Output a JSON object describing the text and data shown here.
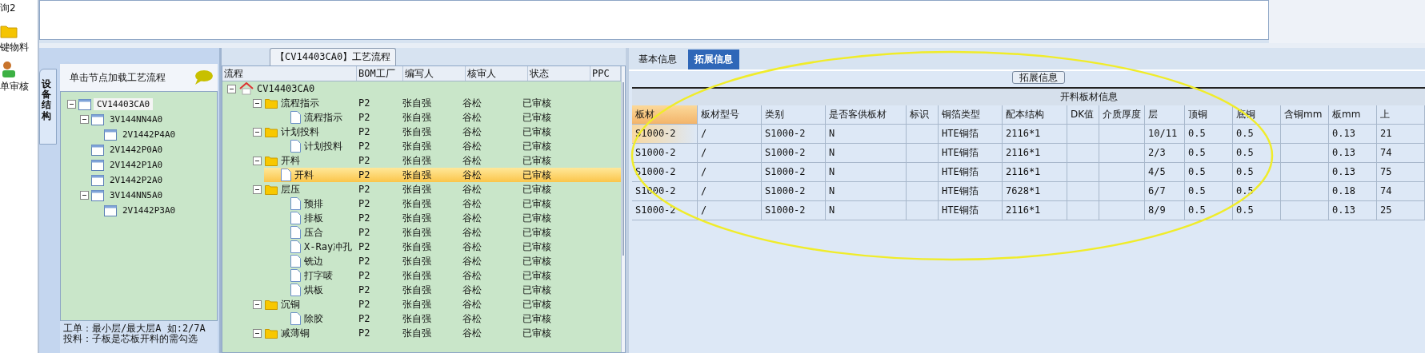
{
  "launcher": [
    {
      "label": "询2",
      "kind": "search"
    },
    {
      "label": "键物料",
      "kind": "folder"
    },
    {
      "label": "单审核",
      "kind": "user"
    }
  ],
  "structure_panel": {
    "tab": "设备结构",
    "hint": "单击节点加载工艺流程",
    "tree": [
      {
        "label": "CV14403CA0",
        "selected": true,
        "expanded": true,
        "children": [
          {
            "label": "3V144NN4A0",
            "selected": false,
            "expanded": true,
            "children": [
              {
                "label": "2V1442P4A0",
                "selected": false
              }
            ]
          },
          {
            "label": "2V1442P0A0",
            "selected": false
          },
          {
            "label": "2V1442P1A0",
            "selected": false
          },
          {
            "label": "2V1442P2A0",
            "selected": false
          },
          {
            "label": "3V144NN5A0",
            "selected": false,
            "expanded": true,
            "children": [
              {
                "label": "2V1442P3A0",
                "selected": false
              }
            ]
          }
        ]
      }
    ],
    "notes": [
      "工单：最小层/最大层A 如:2/7A",
      "投料：子板是芯板开料的需勾选"
    ]
  },
  "process_panel": {
    "title": "【CV14403CA0】工艺流程",
    "columns": [
      "流程",
      "BOM工厂",
      "编写人",
      "核审人",
      "状态",
      "PPC"
    ],
    "tree": [
      {
        "label": "CV14403CA0",
        "kind": "root",
        "selected": false,
        "expanded": true,
        "children": [
          {
            "label": "流程指示",
            "kind": "folder",
            "bom": "P2",
            "writer": "张自强",
            "reviewer": "谷松",
            "status": "已审核",
            "selected": false,
            "expanded": true,
            "children": [
              {
                "label": "流程指示",
                "kind": "file",
                "bom": "P2",
                "writer": "张自强",
                "reviewer": "谷松",
                "status": "已审核",
                "selected": false
              }
            ]
          },
          {
            "label": "计划投料",
            "kind": "folder",
            "bom": "P2",
            "writer": "张自强",
            "reviewer": "谷松",
            "status": "已审核",
            "selected": false,
            "expanded": true,
            "children": [
              {
                "label": "计划投料",
                "kind": "file",
                "bom": "P2",
                "writer": "张自强",
                "reviewer": "谷松",
                "status": "已审核",
                "selected": false
              }
            ]
          },
          {
            "label": "开料",
            "kind": "folder",
            "bom": "P2",
            "writer": "张自强",
            "reviewer": "谷松",
            "status": "已审核",
            "selected": false,
            "expanded": true,
            "children": [
              {
                "label": "开料",
                "kind": "file",
                "bom": "P2",
                "writer": "张自强",
                "reviewer": "谷松",
                "status": "已审核",
                "selected": true
              }
            ]
          },
          {
            "label": "层压",
            "kind": "folder",
            "bom": "P2",
            "writer": "张自强",
            "reviewer": "谷松",
            "status": "已审核",
            "selected": false,
            "expanded": true,
            "children": [
              {
                "label": "预排",
                "kind": "file",
                "bom": "P2",
                "writer": "张自强",
                "reviewer": "谷松",
                "status": "已审核",
                "selected": false
              },
              {
                "label": "排板",
                "kind": "file",
                "bom": "P2",
                "writer": "张自强",
                "reviewer": "谷松",
                "status": "已审核",
                "selected": false
              },
              {
                "label": "压合",
                "kind": "file",
                "bom": "P2",
                "writer": "张自强",
                "reviewer": "谷松",
                "status": "已审核",
                "selected": false
              },
              {
                "label": "X-Ray冲孔",
                "kind": "file",
                "bom": "P2",
                "writer": "张自强",
                "reviewer": "谷松",
                "status": "已审核",
                "selected": false
              },
              {
                "label": "铣边",
                "kind": "file",
                "bom": "P2",
                "writer": "张自强",
                "reviewer": "谷松",
                "status": "已审核",
                "selected": false
              },
              {
                "label": "打字唛",
                "kind": "file",
                "bom": "P2",
                "writer": "张自强",
                "reviewer": "谷松",
                "status": "已审核",
                "selected": false
              },
              {
                "label": "烘板",
                "kind": "file",
                "bom": "P2",
                "writer": "张自强",
                "reviewer": "谷松",
                "status": "已审核",
                "selected": false
              }
            ]
          },
          {
            "label": "沉铜",
            "kind": "folder",
            "bom": "P2",
            "writer": "张自强",
            "reviewer": "谷松",
            "status": "已审核",
            "selected": false,
            "expanded": true,
            "children": [
              {
                "label": "除胶",
                "kind": "file",
                "bom": "P2",
                "writer": "张自强",
                "reviewer": "谷松",
                "status": "已审核",
                "selected": false
              }
            ]
          },
          {
            "label": "减薄铜",
            "kind": "folder",
            "bom": "P2",
            "writer": "张自强",
            "reviewer": "谷松",
            "status": "已审核",
            "selected": false,
            "expanded": true
          }
        ]
      }
    ]
  },
  "detail_panel": {
    "tabs": [
      {
        "label": "基本信息",
        "selected": false
      },
      {
        "label": "拓展信息",
        "selected": true
      }
    ],
    "group_button": "拓展信息",
    "table_title": "开料板材信息",
    "columns": [
      "板材",
      "板材型号",
      "类别",
      "是否客供板材",
      "标识",
      "铜箔类型",
      "配本结构",
      "DK值",
      "介质厚度",
      "层",
      "顶铜",
      "底铜",
      "含铜mm",
      "板mm",
      "上"
    ],
    "rows": [
      {
        "selected": true,
        "cells": [
          "S1000-2",
          "/",
          "S1000-2",
          "N",
          "",
          "HTE铜箔",
          "2116*1",
          "",
          "",
          "10/11",
          "0.5",
          "0.5",
          "",
          "0.13",
          "21"
        ]
      },
      {
        "selected": false,
        "cells": [
          "S1000-2",
          "/",
          "S1000-2",
          "N",
          "",
          "HTE铜箔",
          "2116*1",
          "",
          "",
          "2/3",
          "0.5",
          "0.5",
          "",
          "0.13",
          "74"
        ]
      },
      {
        "selected": false,
        "cells": [
          "S1000-2",
          "/",
          "S1000-2",
          "N",
          "",
          "HTE铜箔",
          "2116*1",
          "",
          "",
          "4/5",
          "0.5",
          "0.5",
          "",
          "0.13",
          "75"
        ]
      },
      {
        "selected": false,
        "cells": [
          "S1000-2",
          "/",
          "S1000-2",
          "N",
          "",
          "HTE铜箔",
          "7628*1",
          "",
          "",
          "6/7",
          "0.5",
          "0.5",
          "",
          "0.18",
          "74"
        ]
      },
      {
        "selected": false,
        "cells": [
          "S1000-2",
          "/",
          "S1000-2",
          "N",
          "",
          "HTE铜箔",
          "2116*1",
          "",
          "",
          "8/9",
          "0.5",
          "0.5",
          "",
          "0.13",
          "25"
        ]
      }
    ]
  }
}
